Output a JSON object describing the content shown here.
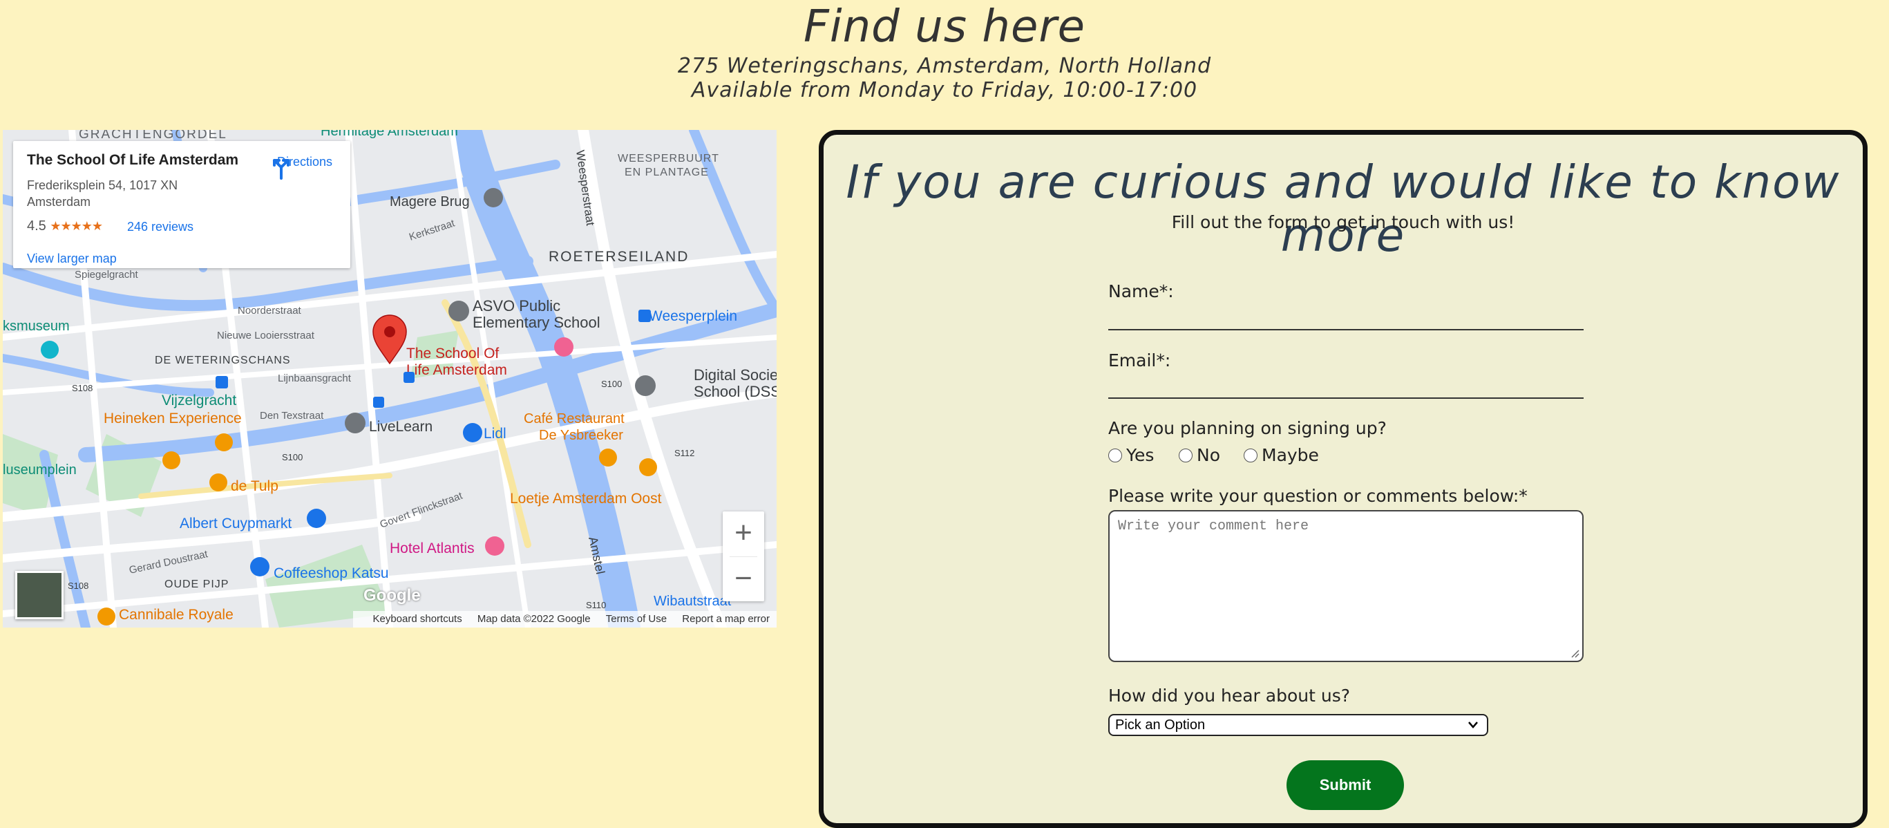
{
  "header": {
    "title": "Find us here",
    "address": "275 Weteringschans, Amsterdam, North Holland",
    "hours": "Available from Monday to Friday, 10:00-17:00"
  },
  "map": {
    "place_name": "The School Of Life Amsterdam",
    "place_address_1": "Frederiksplein 54, 1017 XN",
    "place_address_2": "Amsterdam",
    "rating": "4.5",
    "stars": "★★★★★",
    "reviews": "246 reviews",
    "directions": "Directions",
    "view_larger": "View larger map",
    "zoom_in": "+",
    "zoom_out": "−",
    "attribution": {
      "shortcuts": "Keyboard shortcuts",
      "map_data": "Map data ©2022 Google",
      "terms": "Terms of Use",
      "report": "Report a map error"
    },
    "logo": "Google",
    "labels": {
      "grachtengordel": "GRACHTENGORDEL",
      "hermitage": "Hermitage Amsterdam",
      "weesperbuurt_1": "WEESPERBUURT",
      "weesperbuurt_2": "EN PLANTAGE",
      "magere_brug": "Magere Brug",
      "roeterseiland": "ROETERSEILAND",
      "asvo_1": "ASVO Public",
      "asvo_2": "Elementary School",
      "weesperplein": "Weesperplein",
      "museum": "ksmuseum",
      "de_weteringschans": "DE WETERINGSCHANS",
      "school_1": "The School Of",
      "school_2": "Life Amsterdam",
      "digital_1": "Digital Society",
      "digital_2": "School (DSS)",
      "vijzelgracht": "Vijzelgracht",
      "heineken": "Heineken Experience",
      "livelearn": "LiveLearn",
      "lidl": "Lidl",
      "cafe_1": "Café Restaurant",
      "cafe_2": "De Ysbreeker",
      "museumplein": "luseumplein",
      "de_tulp": "de Tulp",
      "loetje": "Loetje Amsterdam Oost",
      "albert": "Albert Cuypmarkt",
      "hotel": "Hotel Atlantis",
      "oude_pijp": "OUDE PIJP",
      "coffeeshop": "Coffeeshop Katsu",
      "cannibale": "Cannibale Royale",
      "wibautstraat": "Wibautstraat",
      "amstel": "Amstel",
      "weesperstraat": "Weesperstraat",
      "spiegelgracht": "Spiegelgracht",
      "noorderstraat": "Noorderstraat",
      "nieuwe_looiersstraat": "Nieuwe Looiersstraat",
      "lijnbaansgracht": "Lijnbaansgracht",
      "den_texstraat": "Den Texstraat",
      "govert": "Govert Flinckstraat",
      "gerard": "Gerard Doustraat",
      "kerkstraat": "Kerkstraat",
      "s100": "S100",
      "s108": "S108",
      "s112": "S112",
      "s110": "S110"
    }
  },
  "form": {
    "heading": "If you are curious and would like to know more",
    "subheading": "Fill out the form to get in touch with us!",
    "name_label": "Name*:",
    "email_label": "Email*:",
    "signup_label": "Are you planning on signing up?",
    "options": [
      "Yes",
      "No",
      "Maybe"
    ],
    "comment_label": "Please write your question or comments below:*",
    "comment_placeholder": "Write your comment here",
    "hear_label": "How did you hear about us?",
    "hear_selected": "Pick an Option",
    "submit": "Submit"
  },
  "colors": {
    "background": "#fdf3c0",
    "card": "#f0efd3",
    "submit": "#04751d",
    "link": "#1a73e8",
    "pin": "#d93025",
    "water": "#9cc0f9"
  }
}
